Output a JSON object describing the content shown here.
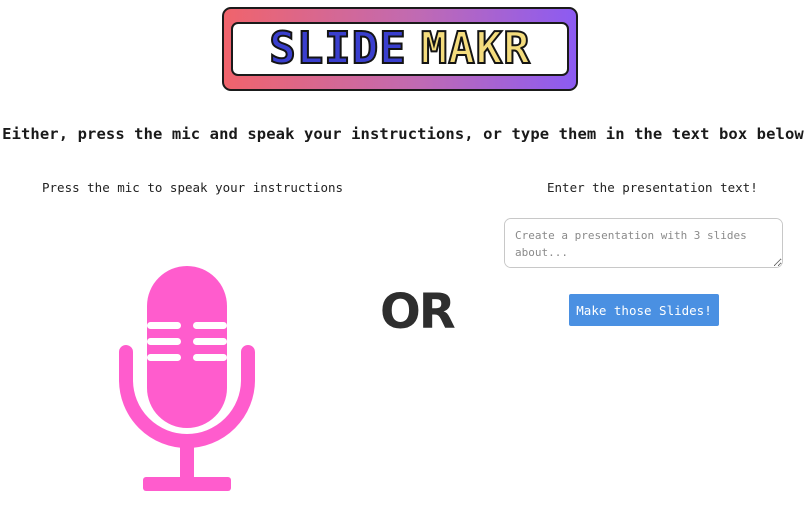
{
  "logo": {
    "word_1": "SLIDE",
    "word_2": "MAKR",
    "colors": {
      "gradient_start": "#f0646c",
      "gradient_end": "#8c5bf2",
      "word_1": "#3a3fce",
      "word_2": "#f4dc7d"
    }
  },
  "headline": "Either, press the mic and speak your instructions, or type them in the text box below",
  "voice": {
    "label": "Press the mic to speak your instructions",
    "icon": "microphone-icon",
    "color": "#ff5ccd"
  },
  "divider_text": "OR",
  "text_input": {
    "label": "Enter the presentation text!",
    "placeholder": "Create a presentation with 3 slides about...",
    "value": ""
  },
  "submit": {
    "label": "Make those Slides!",
    "color": "#4a90e2"
  }
}
